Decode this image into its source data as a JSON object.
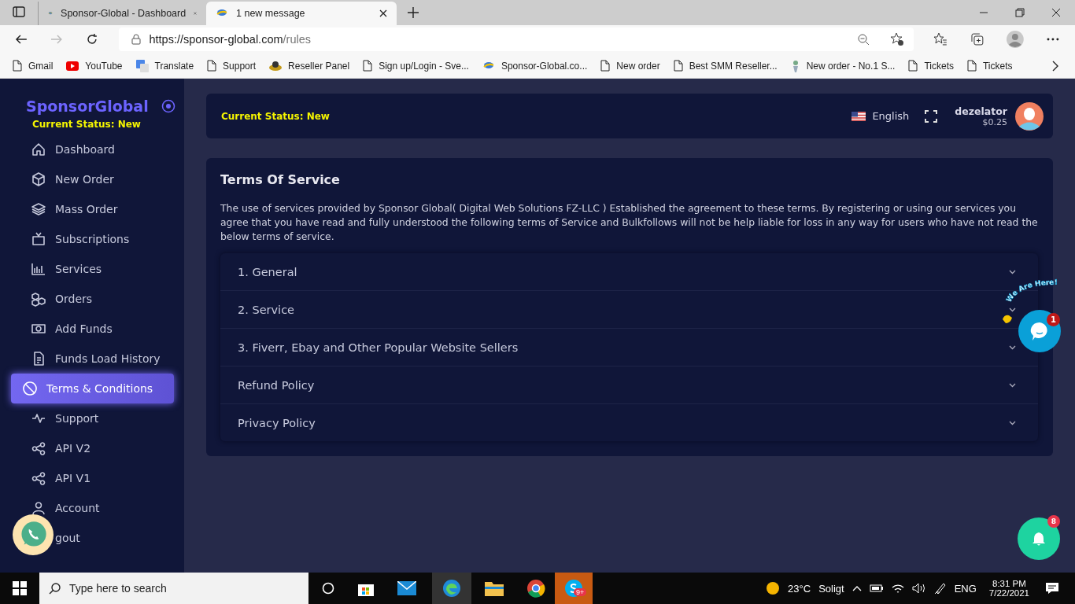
{
  "browser": {
    "tabs": [
      {
        "title": "Sponsor-Global - Dashboard",
        "selected": false
      },
      {
        "title": "1 new message",
        "selected": true
      }
    ],
    "url_host": "https://sponsor-global.com",
    "url_path": "/rules",
    "bookmarks": [
      "Gmail",
      "YouTube",
      "Translate",
      "Support",
      "Reseller Panel",
      "Sign up/Login - Sve...",
      "Sponsor-Global.co...",
      "New order",
      "Best SMM Reseller...",
      "New order - No.1 S...",
      "Tickets",
      "Tickets"
    ]
  },
  "sidebar": {
    "brand": "SponsorGlobal",
    "status": "Current Status: New",
    "items": [
      {
        "label": "Dashboard",
        "selected": false
      },
      {
        "label": "New Order",
        "selected": false
      },
      {
        "label": "Mass Order",
        "selected": false
      },
      {
        "label": "Subscriptions",
        "selected": false
      },
      {
        "label": "Services",
        "selected": false
      },
      {
        "label": "Orders",
        "selected": false
      },
      {
        "label": "Add Funds",
        "selected": false
      },
      {
        "label": "Funds Load History",
        "selected": false
      },
      {
        "label": "Terms & Conditions",
        "selected": true
      },
      {
        "label": "Support",
        "selected": false
      },
      {
        "label": "API V2",
        "selected": false
      },
      {
        "label": "API V1",
        "selected": false
      },
      {
        "label": "Account",
        "selected": false
      },
      {
        "label": "gout",
        "selected": false
      }
    ]
  },
  "header": {
    "status": "Current Status: New",
    "language": "English",
    "username": "dezelator",
    "balance": "$0.25"
  },
  "terms": {
    "title": "Terms Of Service",
    "intro": "The use of services provided by Sponsor Global( Digital Web Solutions FZ-LLC ) Established the agreement to these terms. By registering or using our services you agree that you have read and fully understood the following terms of Service and Bulkfollows will not be help liable for loss in any way for users who have not read the below terms of service.",
    "sections": [
      "1. General",
      "2. Service",
      "3. Fiverr, Ebay and Other Popular Website Sellers",
      "Refund Policy",
      "Privacy Policy"
    ]
  },
  "chat": {
    "tagline": "We Are Here!",
    "badge": "1"
  },
  "notifications": {
    "badge": "8"
  },
  "taskbar": {
    "search_placeholder": "Type here to search",
    "skype_badge": "9+",
    "temperature": "23°C",
    "weather": "Soligt",
    "language": "ENG",
    "time": "8:31 PM",
    "date": "7/22/2021"
  }
}
